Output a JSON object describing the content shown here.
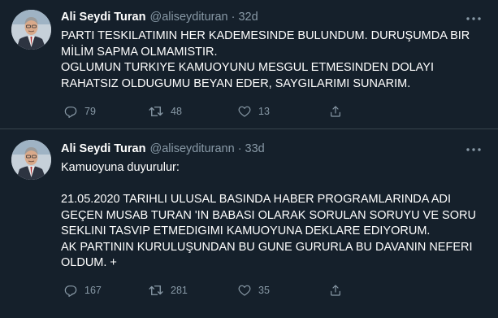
{
  "colors": {
    "background": "#15202b",
    "divider": "#38444d",
    "secondary_text": "#8899a6",
    "primary_text": "#ffffff"
  },
  "tweets": [
    {
      "author_name": "Ali Seydi Turan",
      "handle": "@aliseydituran",
      "separator": "·",
      "time": "32d",
      "paragraphs": [
        "PARTI TESKILATIMIN HER KADEMESINDE BULUNDUM. DURUŞUMDA BIR MİLİM SAPMA OLMAMISTIR.",
        "OGLUMUN TURKIYE KAMUOYUNU MESGUL ETMESINDEN DOLAYI RAHATSIZ OLDUGUMU BEYAN EDER, SAYGILARIMI SUNARIM."
      ],
      "replies": "79",
      "retweets": "48",
      "likes": "13"
    },
    {
      "author_name": "Ali Seydi Turan",
      "handle": "@aliseyditurann",
      "separator": "·",
      "time": "33d",
      "paragraphs": [
        "Kamuoyuna duyurulur:",
        "",
        "21.05.2020 TARIHLI ULUSAL BASINDA HABER PROGRAMLARINDA ADI GEÇEN MUSAB TURAN 'IN BABASI OLARAK SORULAN SORUYU VE SORU SEKLINI TASVIP ETMEDIGIMI KAMUOYUNA DEKLARE EDIYORUM.",
        "AK PARTININ KURULUŞUNDAN BU GUNE  GURURLA BU DAVANIN NEFERI OLDUM. +"
      ],
      "replies": "167",
      "retweets": "281",
      "likes": "35"
    }
  ]
}
